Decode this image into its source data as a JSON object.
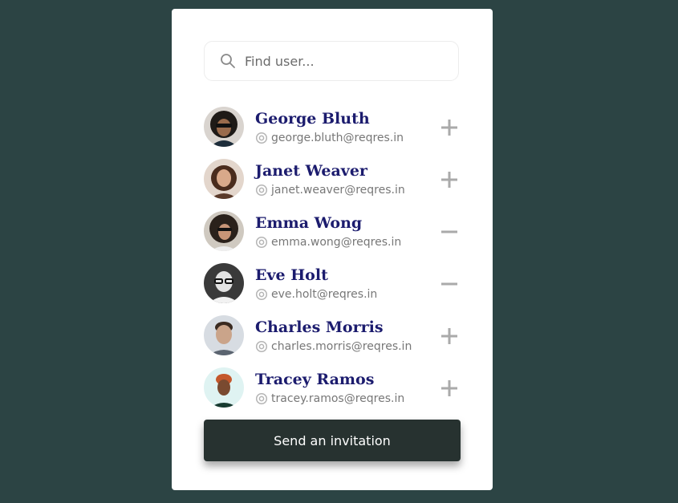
{
  "search": {
    "placeholder": "Find user...",
    "value": "",
    "icon": "search-icon"
  },
  "users": [
    {
      "name": "George Bluth",
      "email": "george.bluth@reqres.in",
      "action": "add",
      "avatar_bg": "#d9d4cf"
    },
    {
      "name": "Janet Weaver",
      "email": "janet.weaver@reqres.in",
      "action": "add",
      "avatar_bg": "#e3d6cc"
    },
    {
      "name": "Emma Wong",
      "email": "emma.wong@reqres.in",
      "action": "remove",
      "avatar_bg": "#cfc9c0"
    },
    {
      "name": "Eve Holt",
      "email": "eve.holt@reqres.in",
      "action": "remove",
      "avatar_bg": "#3a3a3a"
    },
    {
      "name": "Charles Morris",
      "email": "charles.morris@reqres.in",
      "action": "add",
      "avatar_bg": "#d7dce2"
    },
    {
      "name": "Tracey Ramos",
      "email": "tracey.ramos@reqres.in",
      "action": "add",
      "avatar_bg": "#dff3f2"
    }
  ],
  "send_button": {
    "label": "Send an invitation"
  },
  "colors": {
    "background": "#2c4444",
    "card": "#ffffff",
    "name_text": "#1c1c6e",
    "email_text": "#777777",
    "toggle_icon": "#aaaaaa",
    "button_bg": "#273230"
  }
}
